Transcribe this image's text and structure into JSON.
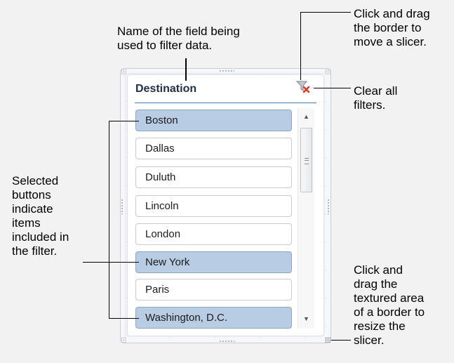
{
  "callouts": {
    "field_name": "Name of the field being\nused to filter data.",
    "move": "Click and drag\nthe border to\nmove a slicer.",
    "clear": "Clear all\nfilters.",
    "selected": "Selected\nbuttons\nindicate\nitems\nincluded in\nthe filter.",
    "resize": "Click and\ndrag the\ntextured area\nof a border to\nresize the\nslicer."
  },
  "slicer": {
    "title": "Destination",
    "items": [
      {
        "label": "Boston",
        "selected": true
      },
      {
        "label": "Dallas",
        "selected": false
      },
      {
        "label": "Duluth",
        "selected": false
      },
      {
        "label": "Lincoln",
        "selected": false
      },
      {
        "label": "London",
        "selected": false
      },
      {
        "label": "New York",
        "selected": true
      },
      {
        "label": "Paris",
        "selected": false
      },
      {
        "label": "Washington, D.C.",
        "selected": true
      }
    ],
    "selected_color": "#b8cce4",
    "unselected_color": "#ffffff",
    "clear_icon": "clear-filter-icon",
    "scroll_up_icon": "scroll-up-arrow-icon",
    "scroll_down_icon": "scroll-down-arrow-icon"
  }
}
